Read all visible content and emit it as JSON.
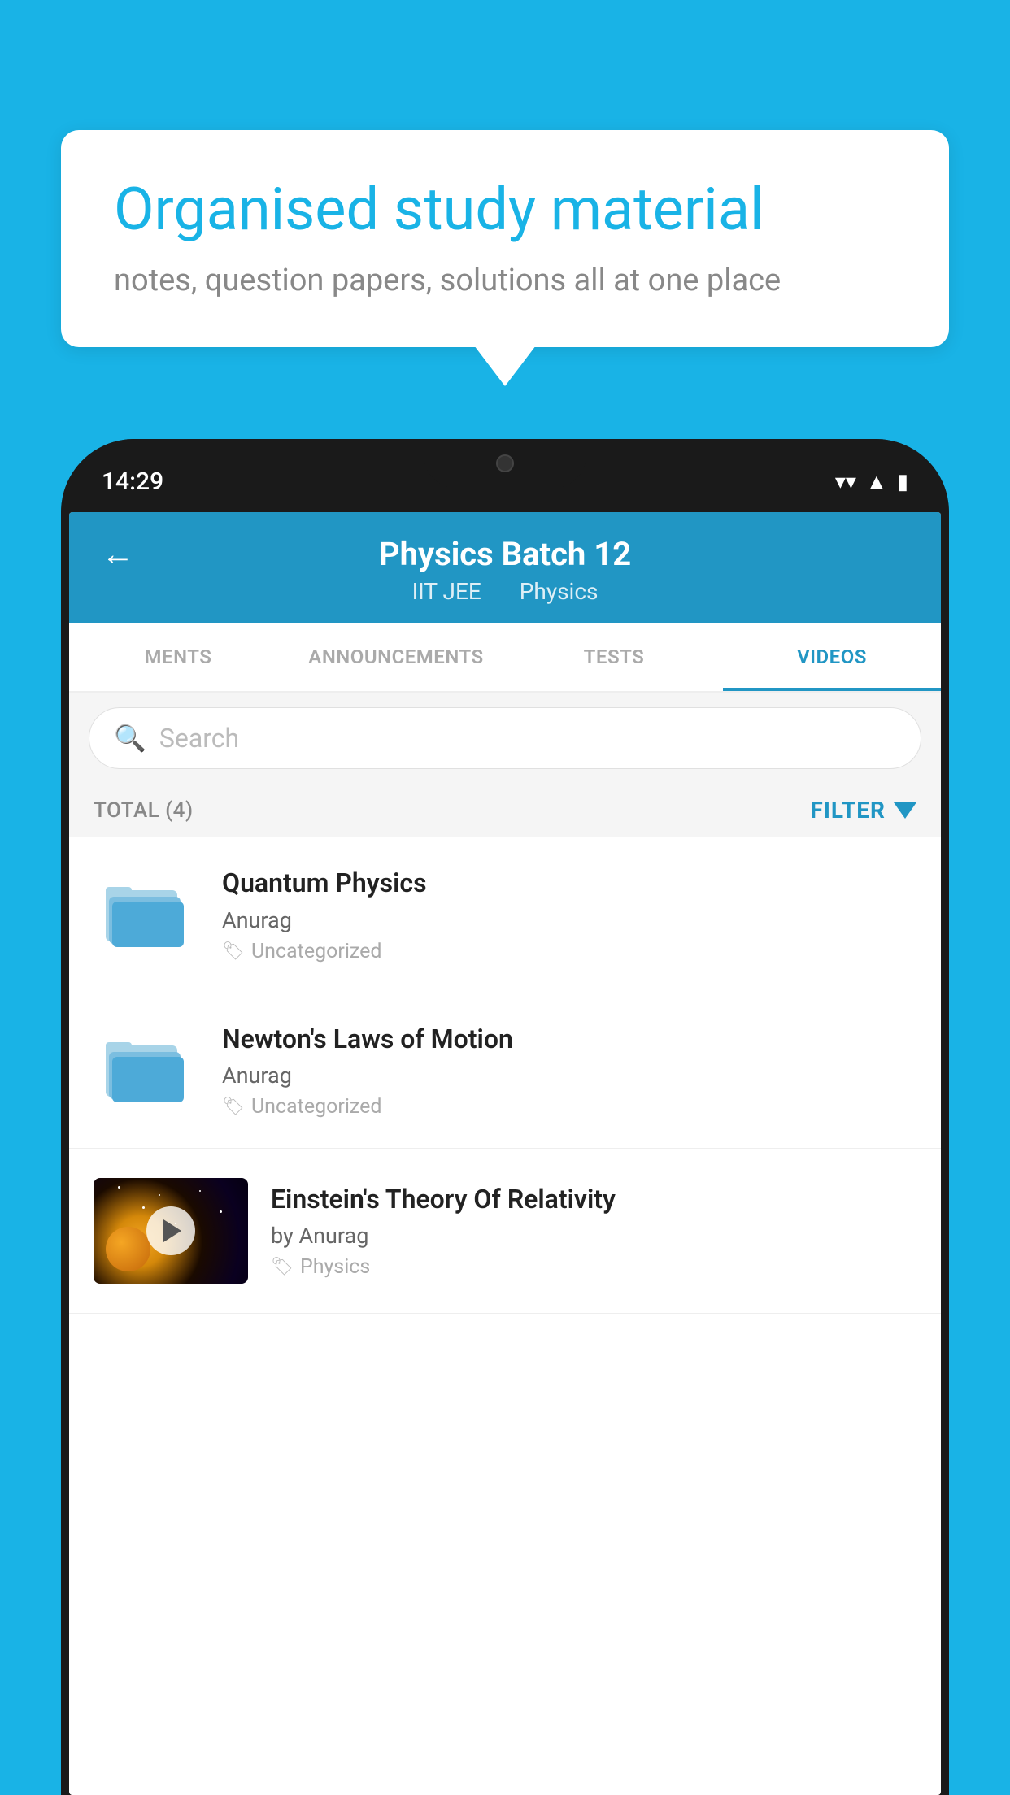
{
  "background": {
    "color": "#19b3e6"
  },
  "speech_bubble": {
    "title": "Organised study material",
    "subtitle": "notes, question papers, solutions all at one place"
  },
  "phone": {
    "time": "14:29",
    "header": {
      "back_label": "←",
      "title": "Physics Batch 12",
      "subtitle_part1": "IIT JEE",
      "subtitle_part2": "Physics"
    },
    "tabs": [
      {
        "label": "MENTS",
        "active": false
      },
      {
        "label": "ANNOUNCEMENTS",
        "active": false
      },
      {
        "label": "TESTS",
        "active": false
      },
      {
        "label": "VIDEOS",
        "active": true
      }
    ],
    "search": {
      "placeholder": "Search"
    },
    "filter_bar": {
      "total_label": "TOTAL (4)",
      "filter_label": "FILTER"
    },
    "videos": [
      {
        "title": "Quantum Physics",
        "author": "Anurag",
        "tag": "Uncategorized",
        "type": "folder"
      },
      {
        "title": "Newton's Laws of Motion",
        "author": "Anurag",
        "tag": "Uncategorized",
        "type": "folder"
      },
      {
        "title": "Einstein's Theory Of Relativity",
        "author": "by Anurag",
        "tag": "Physics",
        "type": "video"
      }
    ]
  }
}
